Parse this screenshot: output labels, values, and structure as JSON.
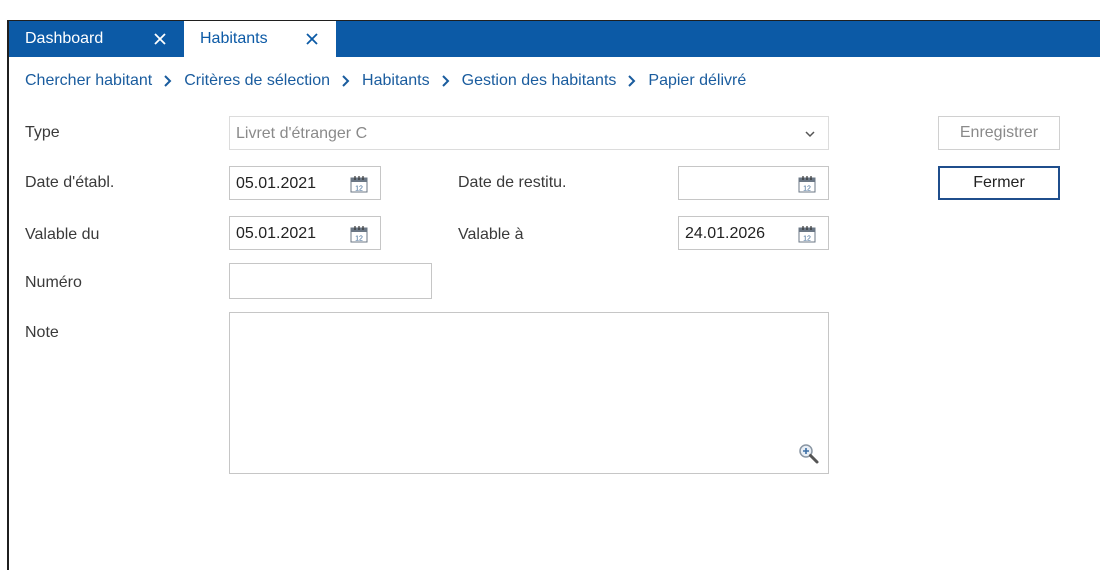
{
  "tabs": [
    {
      "label": "Dashboard",
      "active": false
    },
    {
      "label": "Habitants",
      "active": true
    }
  ],
  "breadcrumb": [
    "Chercher habitant",
    "Critères de sélection",
    "Habitants",
    "Gestion des habitants",
    "Papier délivré"
  ],
  "form": {
    "type_label": "Type",
    "type_value": "Livret d'étranger C",
    "date_etabl_label": "Date d'établ.",
    "date_etabl_value": "05.01.2021",
    "date_restitu_label": "Date de restitu.",
    "date_restitu_value": "",
    "valable_du_label": "Valable du",
    "valable_du_value": "05.01.2021",
    "valable_a_label": "Valable à",
    "valable_a_value": "24.01.2026",
    "numero_label": "Numéro",
    "numero_value": "",
    "note_label": "Note",
    "note_value": ""
  },
  "buttons": {
    "save": "Enregistrer",
    "close": "Fermer"
  },
  "icons": {
    "tab_close": "close-icon",
    "breadcrumb_sep": "chevron-right-icon",
    "calendar": "calendar-icon",
    "dropdown": "chevron-down-icon",
    "zoom": "zoom-in-icon"
  },
  "colors": {
    "tabbar": "#0c5aa6",
    "link": "#1a5c9e",
    "primary_border": "#1f4e8c"
  }
}
